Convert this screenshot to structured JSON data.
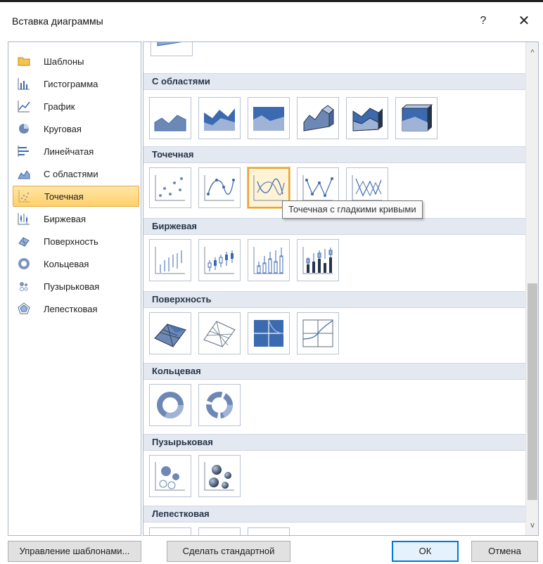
{
  "dialog": {
    "title": "Вставка диаграммы",
    "help_glyph": "?",
    "close_glyph": "✕"
  },
  "categories": [
    {
      "label": "Шаблоны",
      "icon": "folder-icon"
    },
    {
      "label": "Гистограмма",
      "icon": "column-chart-icon"
    },
    {
      "label": "График",
      "icon": "line-chart-icon"
    },
    {
      "label": "Круговая",
      "icon": "pie-chart-icon"
    },
    {
      "label": "Линейчатая",
      "icon": "bar-chart-icon"
    },
    {
      "label": "С областями",
      "icon": "area-chart-icon"
    },
    {
      "label": "Точечная",
      "icon": "scatter-chart-icon",
      "selected": true
    },
    {
      "label": "Биржевая",
      "icon": "stock-chart-icon"
    },
    {
      "label": "Поверхность",
      "icon": "surface-chart-icon"
    },
    {
      "label": "Кольцевая",
      "icon": "doughnut-chart-icon"
    },
    {
      "label": "Пузырьковая",
      "icon": "bubble-chart-icon"
    },
    {
      "label": "Лепестковая",
      "icon": "radar-chart-icon"
    }
  ],
  "gallery": {
    "sections": [
      {
        "title": "С областями",
        "thumb_count": 6
      },
      {
        "title": "Точечная",
        "thumb_count": 5,
        "hovered_index": 2
      },
      {
        "title": "Биржевая",
        "thumb_count": 4
      },
      {
        "title": "Поверхность",
        "thumb_count": 4
      },
      {
        "title": "Кольцевая",
        "thumb_count": 2
      },
      {
        "title": "Пузырьковая",
        "thumb_count": 2
      },
      {
        "title": "Лепестковая",
        "thumb_count": 3
      }
    ],
    "tooltip": "Точечная с гладкими кривыми",
    "scroll_up_glyph": "^",
    "scroll_down_glyph": "v"
  },
  "footer": {
    "manage_templates": "Управление шаблонами...",
    "set_default": "Сделать стандартной",
    "ok": "ОК",
    "cancel": "Отмена"
  },
  "colors": {
    "accent_blue": "#3b6ab0",
    "selection_orange": "#ffd069",
    "section_header_bg": "#e4e9f1"
  }
}
